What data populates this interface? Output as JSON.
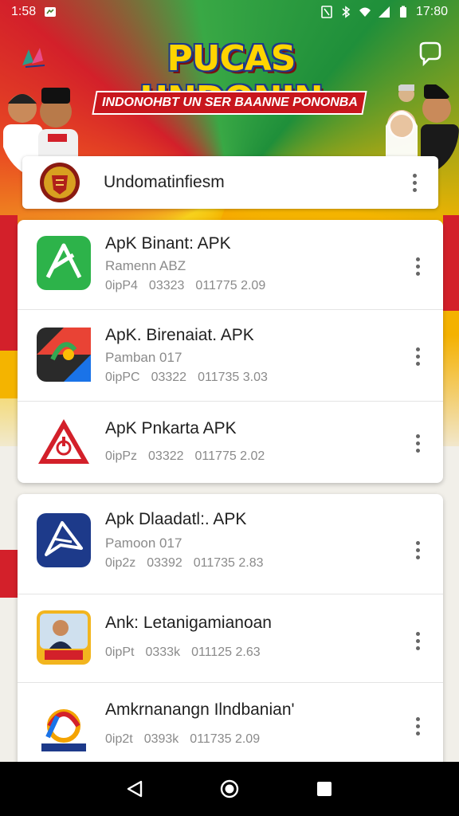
{
  "status_bar": {
    "time": "1:58",
    "right_text": "17:80",
    "icons": [
      "notification-icon",
      "nfc-icon",
      "bluetooth-icon",
      "wifi-icon",
      "signal-icon",
      "battery-icon"
    ]
  },
  "banner": {
    "title": "PUCAS UNDONIN",
    "subtitle": "INDONOHBT UN SER BAANNE PONONBA"
  },
  "header_card": {
    "title": "Undomatinfiesm"
  },
  "group1": [
    {
      "name": "ApK Binant: APK",
      "sub": "Ramenn ABZ",
      "meta": [
        "0ipP4",
        "03323",
        "011775  2.09"
      ],
      "icon": "green-arrow-icon"
    },
    {
      "name": "ApK. Birenaiat. APK",
      "sub": "Pamban 017",
      "meta": [
        "0ipPC",
        "03322",
        "011735  3.03"
      ],
      "icon": "map-pin-icon"
    },
    {
      "name": "ApK  Pnkarta APK",
      "sub": "",
      "meta": [
        "0ipPz",
        "03322",
        "011775  2.02"
      ],
      "icon": "warning-triangle-icon"
    }
  ],
  "group2": [
    {
      "name": "Apk Dlaadatl:. APK",
      "sub": "Pamoon 017",
      "meta": [
        "0ip2z",
        "03392",
        "011735  2.83"
      ],
      "icon": "blue-send-icon"
    },
    {
      "name": "Ank: Letanigamianoan",
      "sub": "",
      "meta": [
        "0ipPt",
        "0333k",
        "011125  2.63"
      ],
      "icon": "person-photo-icon"
    },
    {
      "name": "Amkrnanangn Ilndbanian'",
      "sub": "",
      "meta": [
        "0ip2t",
        "0393k",
        "011735  2.09"
      ],
      "icon": "colorful-circle-icon"
    }
  ],
  "colors": {
    "red": "#d3202a",
    "yellow": "#f4b400",
    "green": "#39a845",
    "blue": "#1d3a8a"
  }
}
